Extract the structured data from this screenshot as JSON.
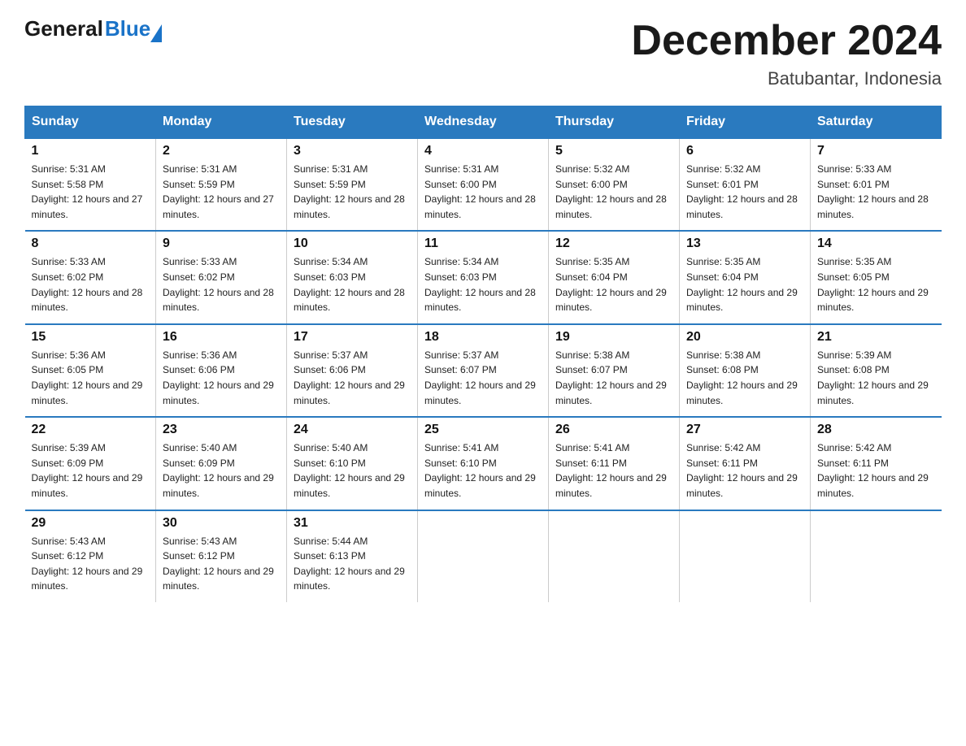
{
  "header": {
    "logo_general": "General",
    "logo_blue": "Blue",
    "month_title": "December 2024",
    "location": "Batubantar, Indonesia"
  },
  "weekdays": [
    "Sunday",
    "Monday",
    "Tuesday",
    "Wednesday",
    "Thursday",
    "Friday",
    "Saturday"
  ],
  "weeks": [
    [
      {
        "day": "1",
        "sunrise": "5:31 AM",
        "sunset": "5:58 PM",
        "daylight": "12 hours and 27 minutes."
      },
      {
        "day": "2",
        "sunrise": "5:31 AM",
        "sunset": "5:59 PM",
        "daylight": "12 hours and 27 minutes."
      },
      {
        "day": "3",
        "sunrise": "5:31 AM",
        "sunset": "5:59 PM",
        "daylight": "12 hours and 28 minutes."
      },
      {
        "day": "4",
        "sunrise": "5:31 AM",
        "sunset": "6:00 PM",
        "daylight": "12 hours and 28 minutes."
      },
      {
        "day": "5",
        "sunrise": "5:32 AM",
        "sunset": "6:00 PM",
        "daylight": "12 hours and 28 minutes."
      },
      {
        "day": "6",
        "sunrise": "5:32 AM",
        "sunset": "6:01 PM",
        "daylight": "12 hours and 28 minutes."
      },
      {
        "day": "7",
        "sunrise": "5:33 AM",
        "sunset": "6:01 PM",
        "daylight": "12 hours and 28 minutes."
      }
    ],
    [
      {
        "day": "8",
        "sunrise": "5:33 AM",
        "sunset": "6:02 PM",
        "daylight": "12 hours and 28 minutes."
      },
      {
        "day": "9",
        "sunrise": "5:33 AM",
        "sunset": "6:02 PM",
        "daylight": "12 hours and 28 minutes."
      },
      {
        "day": "10",
        "sunrise": "5:34 AM",
        "sunset": "6:03 PM",
        "daylight": "12 hours and 28 minutes."
      },
      {
        "day": "11",
        "sunrise": "5:34 AM",
        "sunset": "6:03 PM",
        "daylight": "12 hours and 28 minutes."
      },
      {
        "day": "12",
        "sunrise": "5:35 AM",
        "sunset": "6:04 PM",
        "daylight": "12 hours and 29 minutes."
      },
      {
        "day": "13",
        "sunrise": "5:35 AM",
        "sunset": "6:04 PM",
        "daylight": "12 hours and 29 minutes."
      },
      {
        "day": "14",
        "sunrise": "5:35 AM",
        "sunset": "6:05 PM",
        "daylight": "12 hours and 29 minutes."
      }
    ],
    [
      {
        "day": "15",
        "sunrise": "5:36 AM",
        "sunset": "6:05 PM",
        "daylight": "12 hours and 29 minutes."
      },
      {
        "day": "16",
        "sunrise": "5:36 AM",
        "sunset": "6:06 PM",
        "daylight": "12 hours and 29 minutes."
      },
      {
        "day": "17",
        "sunrise": "5:37 AM",
        "sunset": "6:06 PM",
        "daylight": "12 hours and 29 minutes."
      },
      {
        "day": "18",
        "sunrise": "5:37 AM",
        "sunset": "6:07 PM",
        "daylight": "12 hours and 29 minutes."
      },
      {
        "day": "19",
        "sunrise": "5:38 AM",
        "sunset": "6:07 PM",
        "daylight": "12 hours and 29 minutes."
      },
      {
        "day": "20",
        "sunrise": "5:38 AM",
        "sunset": "6:08 PM",
        "daylight": "12 hours and 29 minutes."
      },
      {
        "day": "21",
        "sunrise": "5:39 AM",
        "sunset": "6:08 PM",
        "daylight": "12 hours and 29 minutes."
      }
    ],
    [
      {
        "day": "22",
        "sunrise": "5:39 AM",
        "sunset": "6:09 PM",
        "daylight": "12 hours and 29 minutes."
      },
      {
        "day": "23",
        "sunrise": "5:40 AM",
        "sunset": "6:09 PM",
        "daylight": "12 hours and 29 minutes."
      },
      {
        "day": "24",
        "sunrise": "5:40 AM",
        "sunset": "6:10 PM",
        "daylight": "12 hours and 29 minutes."
      },
      {
        "day": "25",
        "sunrise": "5:41 AM",
        "sunset": "6:10 PM",
        "daylight": "12 hours and 29 minutes."
      },
      {
        "day": "26",
        "sunrise": "5:41 AM",
        "sunset": "6:11 PM",
        "daylight": "12 hours and 29 minutes."
      },
      {
        "day": "27",
        "sunrise": "5:42 AM",
        "sunset": "6:11 PM",
        "daylight": "12 hours and 29 minutes."
      },
      {
        "day": "28",
        "sunrise": "5:42 AM",
        "sunset": "6:11 PM",
        "daylight": "12 hours and 29 minutes."
      }
    ],
    [
      {
        "day": "29",
        "sunrise": "5:43 AM",
        "sunset": "6:12 PM",
        "daylight": "12 hours and 29 minutes."
      },
      {
        "day": "30",
        "sunrise": "5:43 AM",
        "sunset": "6:12 PM",
        "daylight": "12 hours and 29 minutes."
      },
      {
        "day": "31",
        "sunrise": "5:44 AM",
        "sunset": "6:13 PM",
        "daylight": "12 hours and 29 minutes."
      },
      null,
      null,
      null,
      null
    ]
  ]
}
